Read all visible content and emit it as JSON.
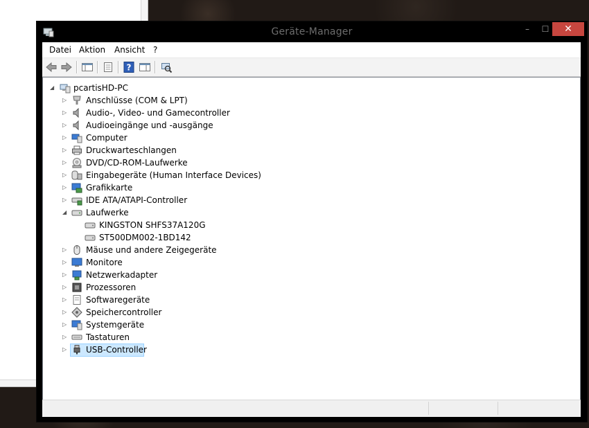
{
  "window": {
    "title": "Geräte-Manager",
    "controls": {
      "minimize": "–",
      "maximize": "☐",
      "close": "✕"
    }
  },
  "menu": [
    "Datei",
    "Aktion",
    "Ansicht",
    "?"
  ],
  "toolbar": [
    "back-arrow-icon",
    "forward-arrow-icon",
    "console-tree-icon",
    "properties-icon",
    "help-icon",
    "action-pane-icon",
    "scan-hardware-icon"
  ],
  "tree": {
    "root": "pcartisHD-PC",
    "items": [
      "Anschlüsse (COM & LPT)",
      "Audio-, Video- und Gamecontroller",
      "Audioeingänge und -ausgänge",
      "Computer",
      "Druckwarteschlangen",
      "DVD/CD-ROM-Laufwerke",
      "Eingabegeräte (Human Interface Devices)",
      "Grafikkarte",
      "IDE ATA/ATAPI-Controller",
      "Laufwerke",
      "KINGSTON SHFS37A120G",
      "ST500DM002-1BD142",
      "Mäuse und andere Zeigegeräte",
      "Monitore",
      "Netzwerkadapter",
      "Prozessoren",
      "Softwaregeräte",
      "Speichercontroller",
      "Systemgeräte",
      "Tastaturen",
      "USB-Controller"
    ]
  },
  "colors": {
    "titlebar": "#000000",
    "close_button": "#c7463f",
    "selection_fill": "#cce8ff",
    "selection_border": "#99d1ff"
  }
}
